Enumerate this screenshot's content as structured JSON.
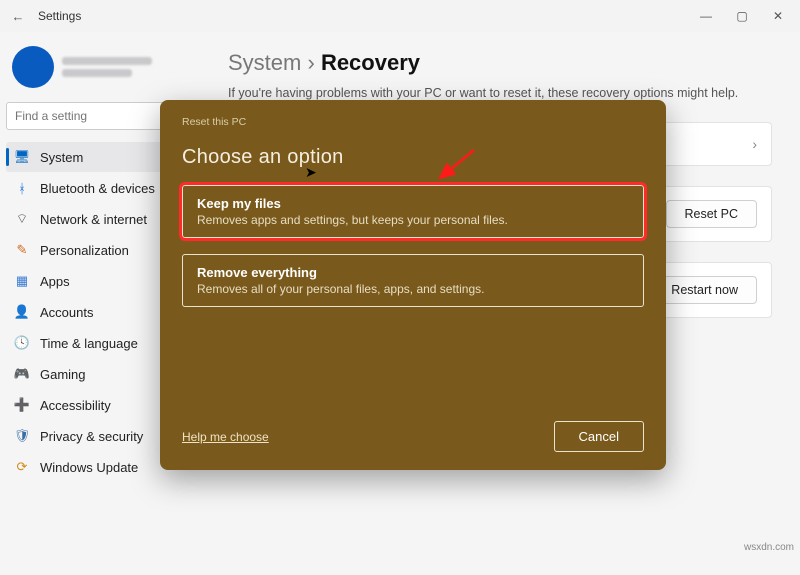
{
  "window": {
    "title": "Settings"
  },
  "search": {
    "placeholder": "Find a setting"
  },
  "sidebar": {
    "items": [
      {
        "label": "System"
      },
      {
        "label": "Bluetooth & devices"
      },
      {
        "label": "Network & internet"
      },
      {
        "label": "Personalization"
      },
      {
        "label": "Apps"
      },
      {
        "label": "Accounts"
      },
      {
        "label": "Time & language"
      },
      {
        "label": "Gaming"
      },
      {
        "label": "Accessibility"
      },
      {
        "label": "Privacy & security"
      },
      {
        "label": "Windows Update"
      }
    ]
  },
  "breadcrumb": {
    "parent": "System",
    "sep": "›",
    "current": "Recovery"
  },
  "page": {
    "subtext": "If you're having problems with your PC or want to reset it, these recovery options might help.",
    "reset_label": "Reset PC",
    "restart_label": "Restart now"
  },
  "dialog": {
    "crumb": "Reset this PC",
    "title": "Choose an option",
    "options": [
      {
        "title": "Keep my files",
        "desc": "Removes apps and settings, but keeps your personal files."
      },
      {
        "title": "Remove everything",
        "desc": "Removes all of your personal files, apps, and settings."
      }
    ],
    "help": "Help me choose",
    "cancel": "Cancel"
  },
  "watermark": "wsxdn.com"
}
